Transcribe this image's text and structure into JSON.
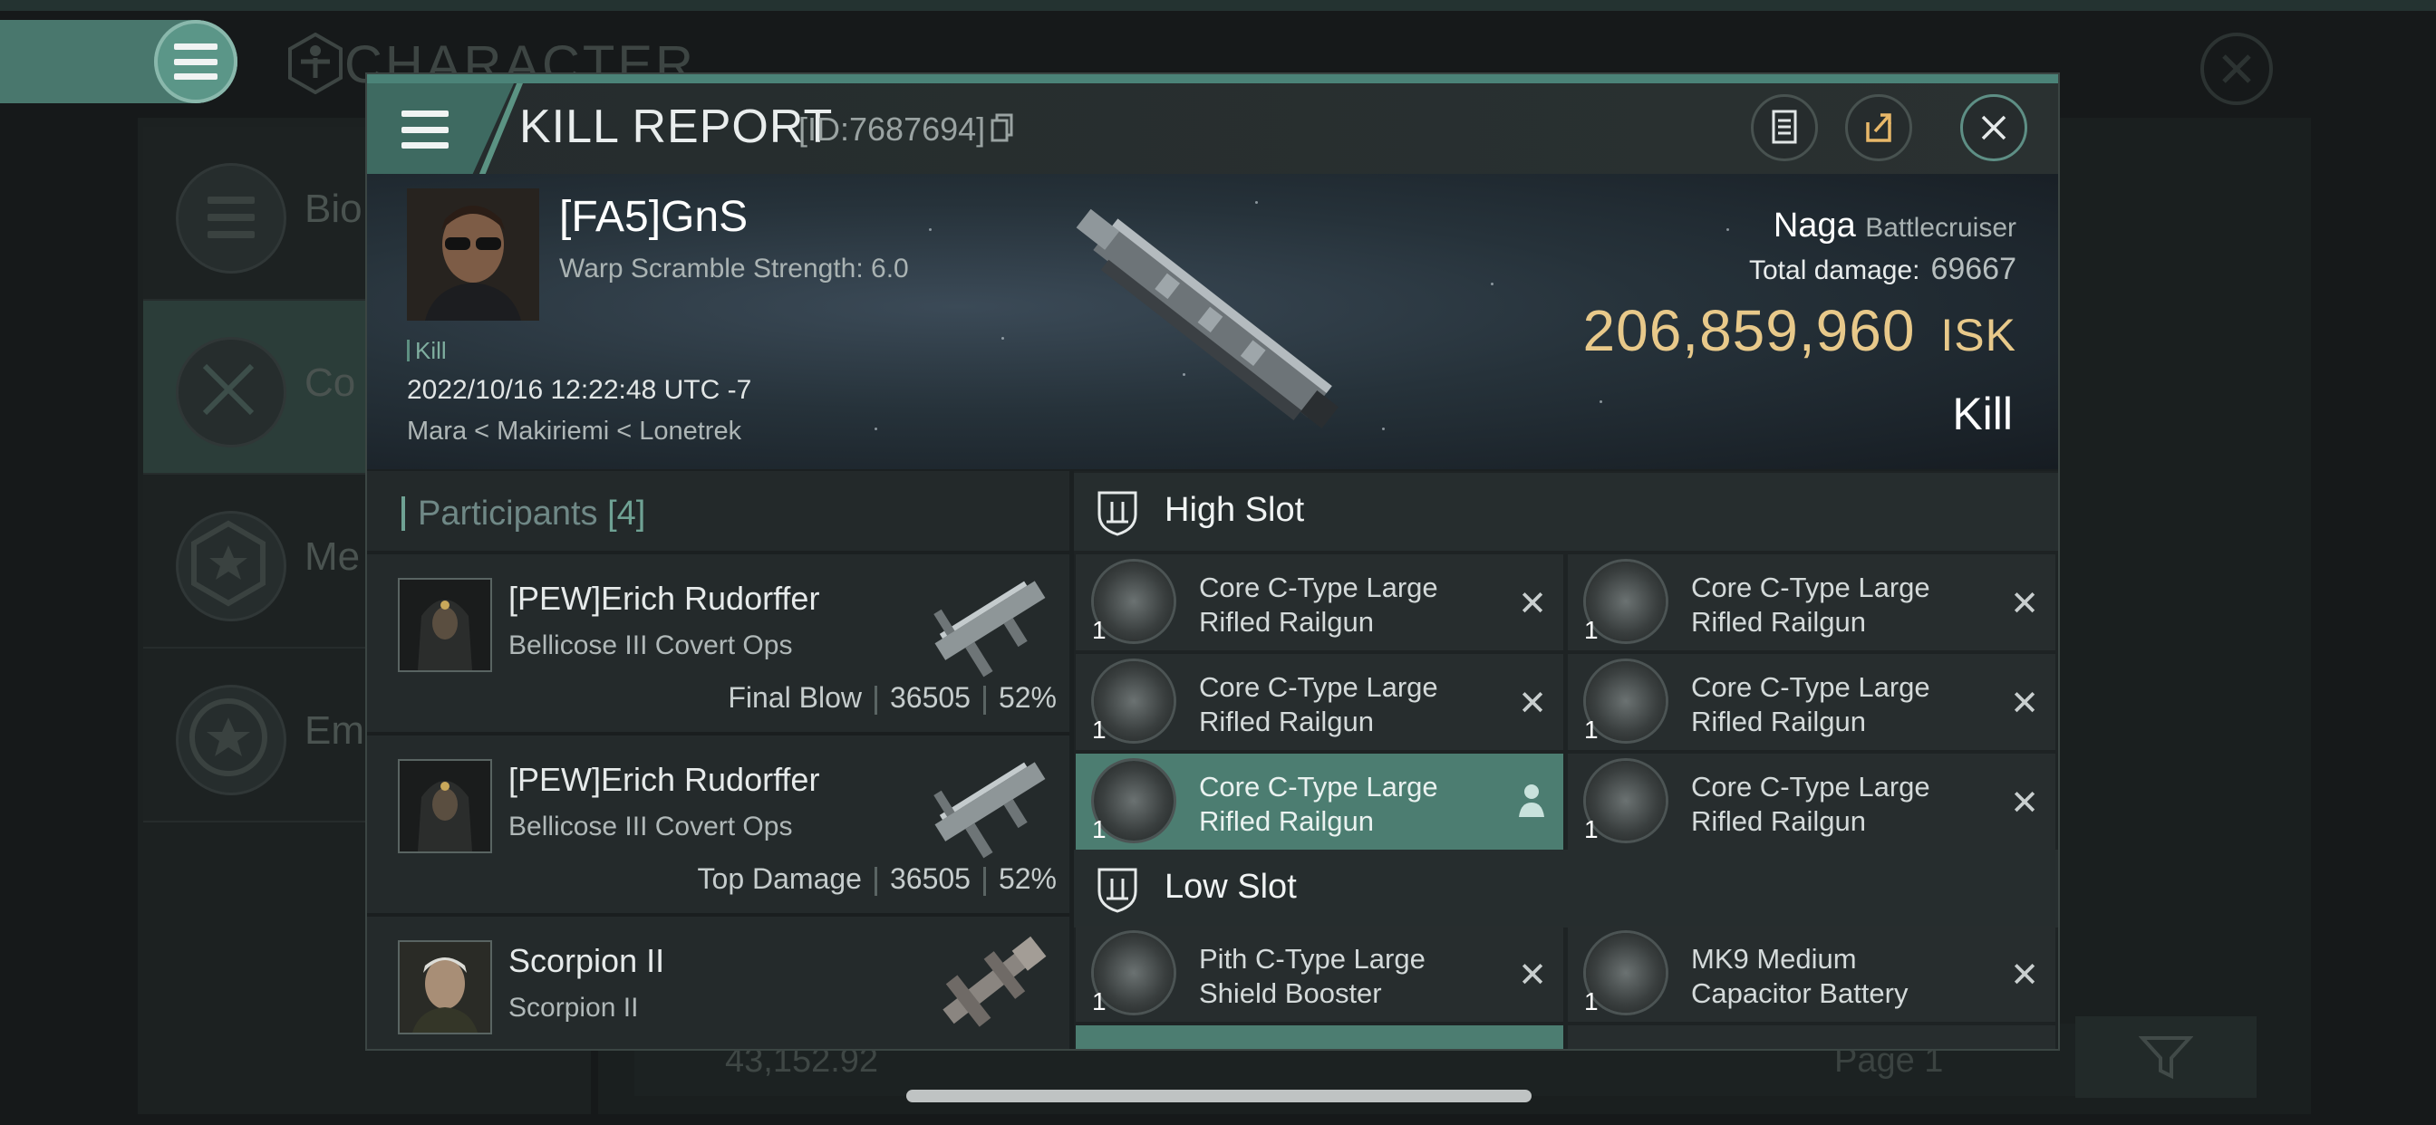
{
  "background": {
    "title": "CHARACTER",
    "side_items": [
      "Bio",
      "Co",
      "Me",
      "Em"
    ],
    "bottom_value": "43,152.92",
    "bottom_page": "Page 1"
  },
  "window": {
    "title": "KILL REPORT",
    "id": "[ID:7687694]"
  },
  "victim": {
    "name": "[FA5]GnS",
    "detail": "Warp Scramble Strength: 6.0",
    "tag": "Kill",
    "time": "2022/10/16 12:22:48 UTC -7",
    "location": "Mara < Makiriemi < Lonetrek"
  },
  "ship": {
    "name": "Naga",
    "class": "Battlecruiser",
    "damage_label": "Total damage:",
    "damage_value": "69667",
    "isk_value": "206,859,960",
    "isk_unit": "ISK",
    "result": "Kill"
  },
  "participants": {
    "label": "Participants",
    "count": "[4]",
    "rows": [
      {
        "name": "[PEW]Erich Rudorffer",
        "ship": "Bellicose III Covert Ops",
        "stat_label": "Final Blow",
        "damage": "36505",
        "percent": "52%"
      },
      {
        "name": "[PEW]Erich Rudorffer",
        "ship": "Bellicose III Covert Ops",
        "stat_label": "Top Damage",
        "damage": "36505",
        "percent": "52%"
      },
      {
        "name": "Scorpion II",
        "ship": "Scorpion II"
      }
    ]
  },
  "slots": {
    "high": {
      "label": "High Slot",
      "items": [
        {
          "qty": "1",
          "line1": "Core C-Type Large",
          "line2": "Rifled Railgun"
        },
        {
          "qty": "1",
          "line1": "Core C-Type Large",
          "line2": "Rifled Railgun"
        },
        {
          "qty": "1",
          "line1": "Core C-Type Large",
          "line2": "Rifled Railgun"
        },
        {
          "qty": "1",
          "line1": "Core C-Type Large",
          "line2": "Rifled Railgun"
        },
        {
          "qty": "1",
          "line1": "Core C-Type Large",
          "line2": "Rifled Railgun"
        },
        {
          "qty": "1",
          "line1": "Core C-Type Large",
          "line2": "Rifled Railgun"
        }
      ]
    },
    "low": {
      "label": "Low Slot",
      "items": [
        {
          "qty": "1",
          "line1": "Pith C-Type Large",
          "line2": "Shield Booster"
        },
        {
          "qty": "1",
          "line1": "MK9 Medium",
          "line2": "Capacitor Battery"
        }
      ]
    }
  },
  "icons": {
    "menu": "hamburger-icon",
    "copy": "copy-icon",
    "clipboard": "clipboard-icon",
    "share": "share-icon",
    "close": "close-icon",
    "remove": "x-icon",
    "person": "person-icon",
    "slot": "slot-shield-icon"
  },
  "colors": {
    "accent": "#4c7d71",
    "isk": "#e8c98a",
    "background": "#16191a"
  }
}
